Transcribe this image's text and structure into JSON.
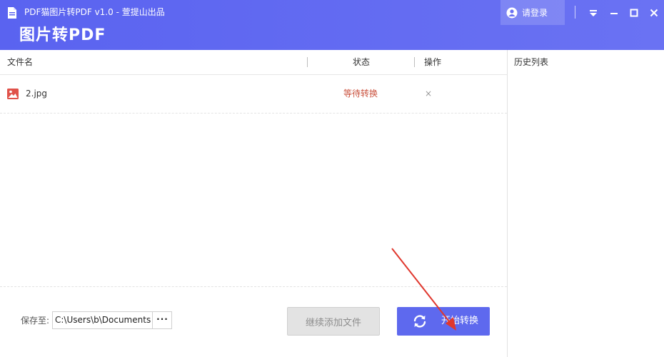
{
  "window": {
    "title": "PDF猫图片转PDF v1.0 - 萱提山出品",
    "brand": "图片转PDF",
    "login_label": "请登录"
  },
  "icons": {
    "app": "app-icon",
    "user": "user-icon",
    "menu": "dropdown-menu-icon",
    "minimize": "minimize-icon",
    "maximize": "maximize-icon",
    "close": "close-icon",
    "file": "image-file-icon",
    "refresh": "refresh-icon"
  },
  "table": {
    "headers": {
      "name": "文件名",
      "status": "状态",
      "action": "操作"
    },
    "rows": [
      {
        "name": "2.jpg",
        "status": "等待转换",
        "remove": "×"
      }
    ]
  },
  "history": {
    "title": "历史列表"
  },
  "footer": {
    "save_label": "保存至:",
    "save_path": "C:\\Users\\b\\Documents",
    "browse_label": "···",
    "add_button": "继续添加文件",
    "start_button": "开始转换"
  },
  "colors": {
    "titlebar": "#5a63f0",
    "primary_button": "#5e69ee",
    "status_waiting": "#c9503c",
    "annotation_arrow": "#e0372d"
  }
}
